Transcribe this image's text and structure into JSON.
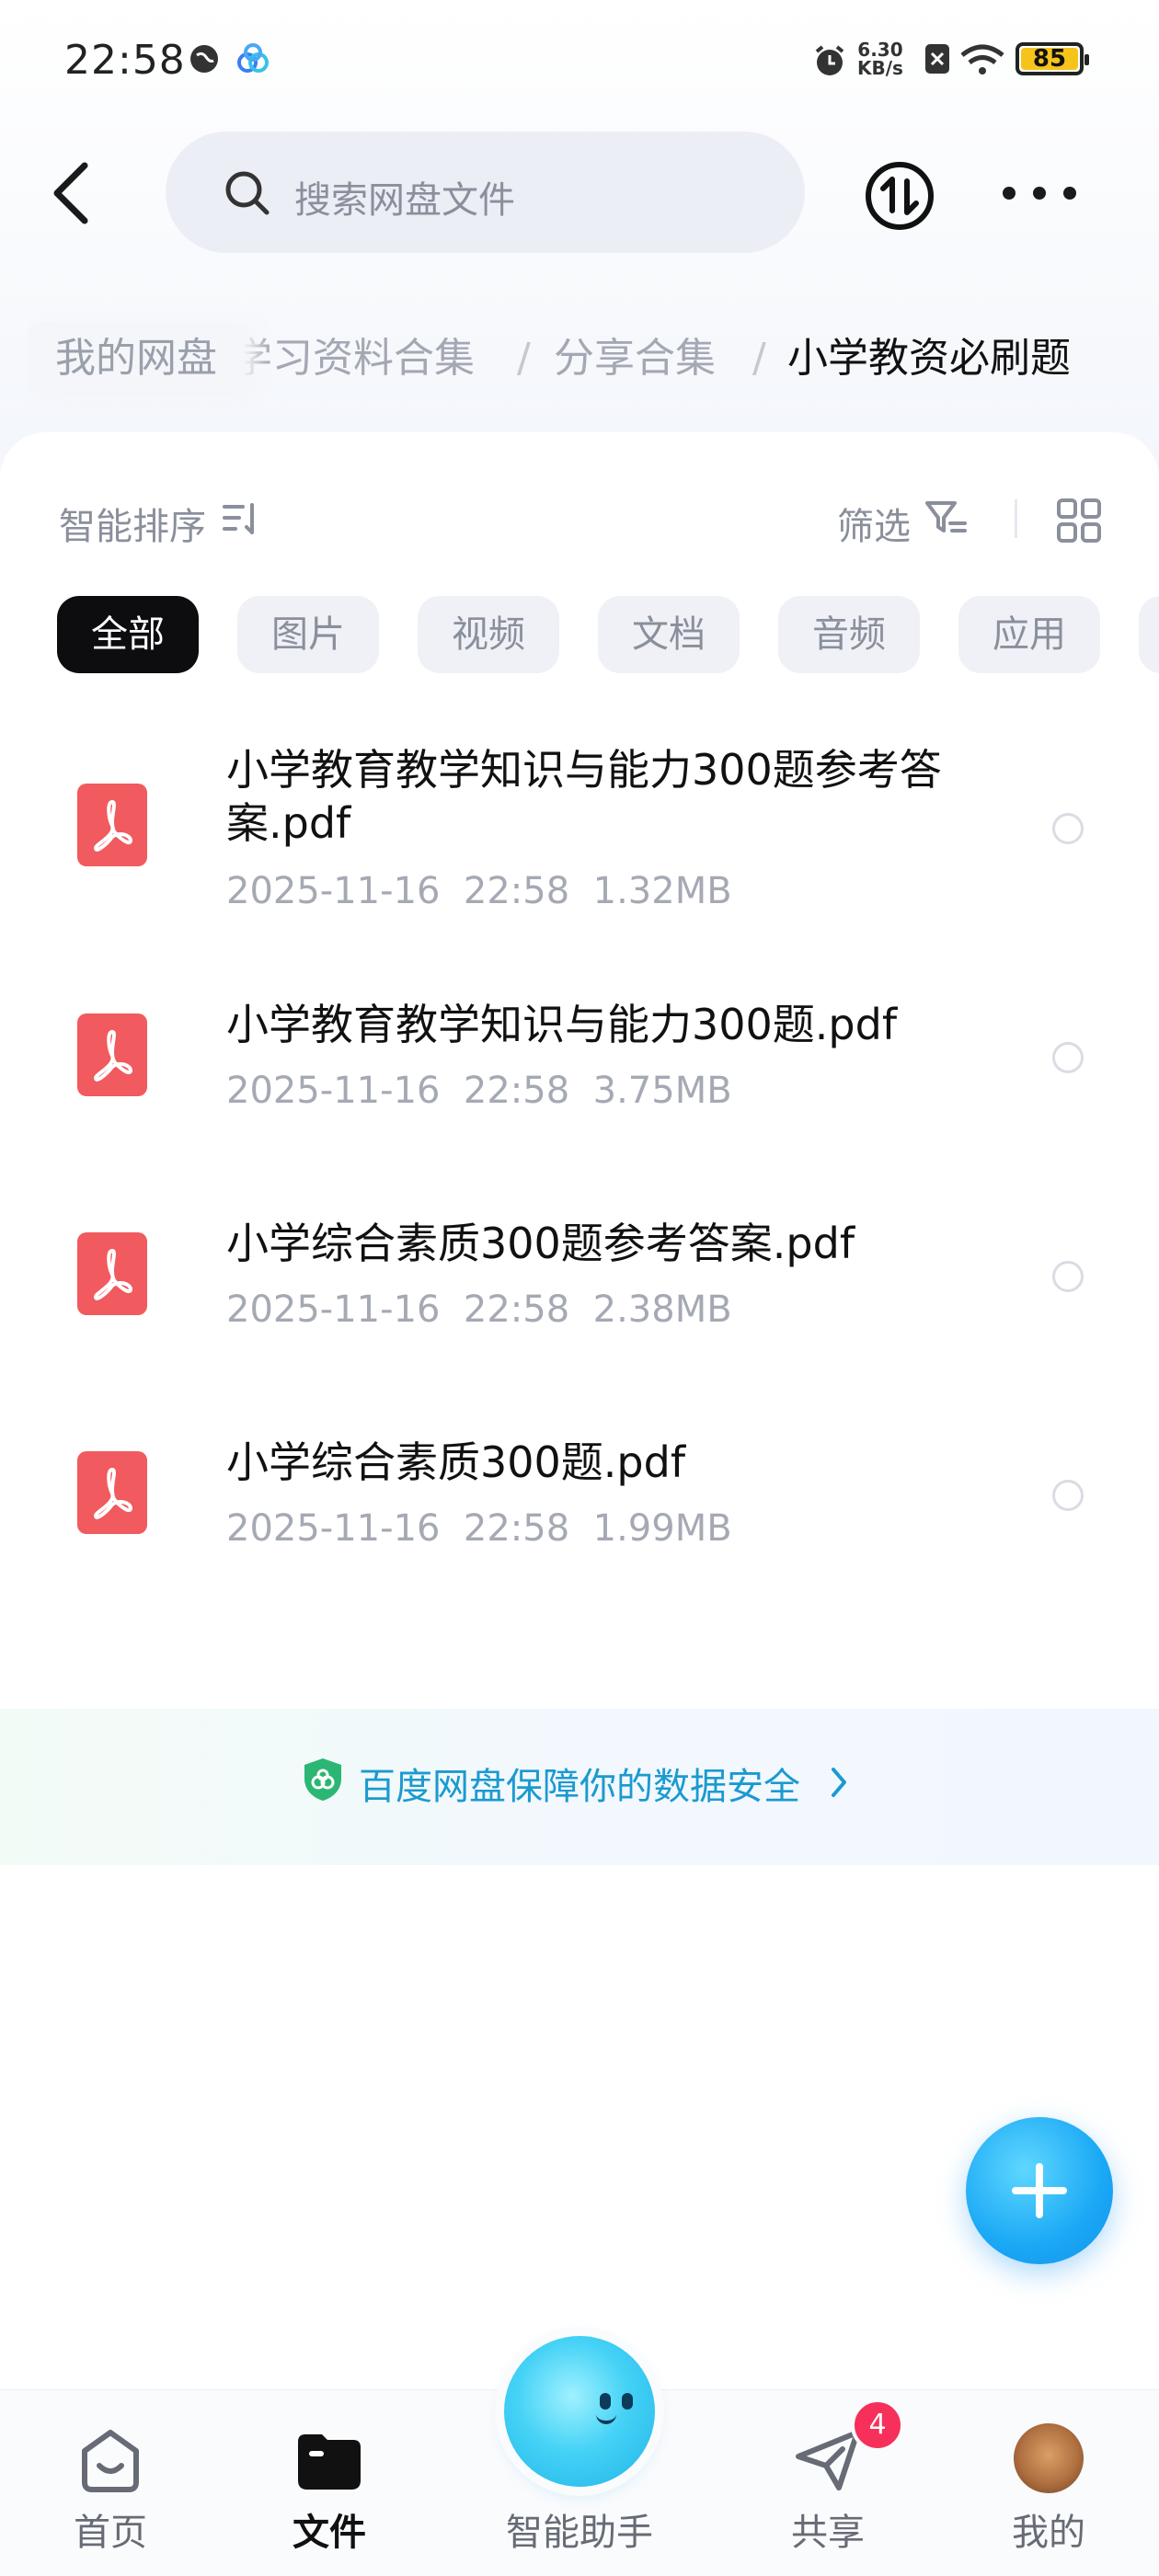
{
  "status_bar": {
    "time": "22:58",
    "net_speed": "6.30",
    "net_unit": "KB/s",
    "battery": "85"
  },
  "header": {
    "search_placeholder": "搜索网盘文件"
  },
  "breadcrumb": {
    "root": "我的网盘",
    "items": [
      "学习资料合集",
      "分享合集",
      "小学教资必刷题"
    ]
  },
  "toolbar": {
    "sort_label": "智能排序",
    "filter_label": "筛选"
  },
  "chips": [
    "全部",
    "图片",
    "视频",
    "文档",
    "音频",
    "应用"
  ],
  "files": [
    {
      "name": "小学教育教学知识与能力300题参考答案.pdf",
      "date": "2025-11-16",
      "time": "22:58",
      "size": "1.32MB"
    },
    {
      "name": "小学教育教学知识与能力300题.pdf",
      "date": "2025-11-16",
      "time": "22:58",
      "size": "3.75MB"
    },
    {
      "name": "小学综合素质300题参考答案.pdf",
      "date": "2025-11-16",
      "time": "22:58",
      "size": "2.38MB"
    },
    {
      "name": "小学综合素质300题.pdf",
      "date": "2025-11-16",
      "time": "22:58",
      "size": "1.99MB"
    }
  ],
  "banner": {
    "text": "百度网盘保障你的数据安全"
  },
  "nav": {
    "home": "首页",
    "files": "文件",
    "assistant": "智能助手",
    "share": "共享",
    "share_badge": "4",
    "mine": "我的"
  },
  "colors": {
    "accent": "#1aa8f5",
    "pdf_red": "#f15a5e",
    "badge": "#f6305a",
    "battery": "#f6c31b"
  }
}
